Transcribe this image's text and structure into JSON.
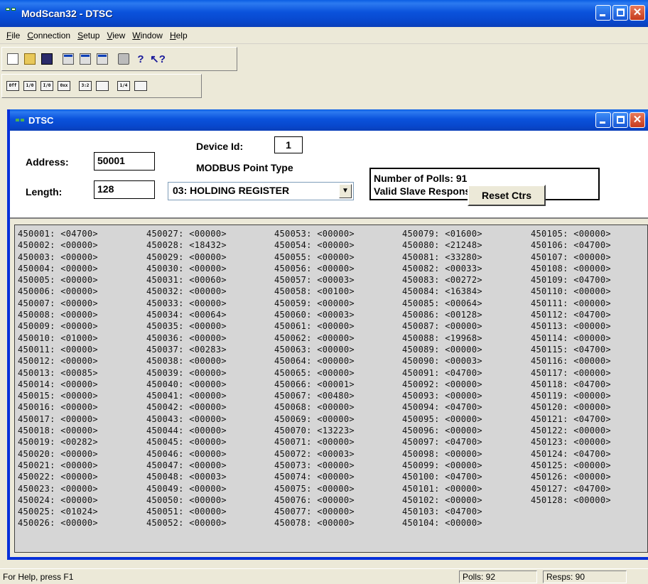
{
  "app": {
    "title": "ModScan32 - DTSC"
  },
  "menu": [
    {
      "pre": "",
      "u": "F",
      "post": "ile"
    },
    {
      "pre": "",
      "u": "C",
      "post": "onnection"
    },
    {
      "pre": "",
      "u": "S",
      "post": "etup"
    },
    {
      "pre": "",
      "u": "V",
      "post": "iew"
    },
    {
      "pre": "",
      "u": "W",
      "post": "indow"
    },
    {
      "pre": "",
      "u": "H",
      "post": "elp"
    }
  ],
  "toolbar2": [
    "0ff",
    "1/0",
    "I/0",
    "0xx",
    "3:2",
    "",
    "1/4",
    ""
  ],
  "doc": {
    "title": "DTSC",
    "address_label": "Address:",
    "address": "50001",
    "length_label": "Length:",
    "length": "128",
    "device_id_label": "Device Id:",
    "device_id": "1",
    "point_type_label": "MODBUS Point Type",
    "point_type": "03: HOLDING REGISTER",
    "polls_line": "Number of Polls: 91",
    "responses_line": "Valid Slave Responses: 90",
    "reset_label": "Reset Ctrs"
  },
  "registers": [
    [
      "450001: <04700>",
      "450002: <00000>",
      "450003: <00000>",
      "450004: <00000>",
      "450005: <00000>",
      "450006: <00000>",
      "450007: <00000>",
      "450008: <00000>",
      "450009: <00000>",
      "450010: <01000>",
      "450011: <00000>",
      "450012: <00000>",
      "450013: <00085>",
      "450014: <00000>",
      "450015: <00000>",
      "450016: <00000>",
      "450017: <00000>",
      "450018: <00000>",
      "450019: <00282>",
      "450020: <00000>",
      "450021: <00000>",
      "450022: <00000>",
      "450023: <00000>",
      "450024: <00000>",
      "450025: <01024>",
      "450026: <00000>"
    ],
    [
      "450027: <00000>",
      "450028: <18432>",
      "450029: <00000>",
      "450030: <00000>",
      "450031: <00060>",
      "450032: <00000>",
      "450033: <00000>",
      "450034: <00064>",
      "450035: <00000>",
      "450036: <00000>",
      "450037: <00283>",
      "450038: <00000>",
      "450039: <00000>",
      "450040: <00000>",
      "450041: <00000>",
      "450042: <00000>",
      "450043: <00000>",
      "450044: <00000>",
      "450045: <00000>",
      "450046: <00000>",
      "450047: <00000>",
      "450048: <00003>",
      "450049: <00000>",
      "450050: <00000>",
      "450051: <00000>",
      "450052: <00000>"
    ],
    [
      "450053: <00000>",
      "450054: <00000>",
      "450055: <00000>",
      "450056: <00000>",
      "450057: <00003>",
      "450058: <00100>",
      "450059: <00000>",
      "450060: <00003>",
      "450061: <00000>",
      "450062: <00000>",
      "450063: <00000>",
      "450064: <00000>",
      "450065: <00000>",
      "450066: <00001>",
      "450067: <00480>",
      "450068: <00000>",
      "450069: <00000>",
      "450070: <13223>",
      "450071: <00000>",
      "450072: <00003>",
      "450073: <00000>",
      "450074: <00000>",
      "450075: <00000>",
      "450076: <00000>",
      "450077: <00000>",
      "450078: <00000>"
    ],
    [
      "450079: <01600>",
      "450080: <21248>",
      "450081: <33280>",
      "450082: <00033>",
      "450083: <00272>",
      "450084: <16384>",
      "450085: <00064>",
      "450086: <00128>",
      "450087: <00000>",
      "450088: <19968>",
      "450089: <00000>",
      "450090: <00003>",
      "450091: <04700>",
      "450092: <00000>",
      "450093: <00000>",
      "450094: <04700>",
      "450095: <00000>",
      "450096: <00000>",
      "450097: <04700>",
      "450098: <00000>",
      "450099: <00000>",
      "450100: <04700>",
      "450101: <00000>",
      "450102: <00000>",
      "450103: <04700>",
      "450104: <00000>"
    ],
    [
      "450105: <00000>",
      "450106: <04700>",
      "450107: <00000>",
      "450108: <00000>",
      "450109: <04700>",
      "450110: <00000>",
      "450111: <00000>",
      "450112: <04700>",
      "450113: <00000>",
      "450114: <00000>",
      "450115: <04700>",
      "450116: <00000>",
      "450117: <00000>",
      "450118: <04700>",
      "450119: <00000>",
      "450120: <00000>",
      "450121: <04700>",
      "450122: <00000>",
      "450123: <00000>",
      "450124: <04700>",
      "450125: <00000>",
      "450126: <00000>",
      "450127: <04700>",
      "450128: <00000>"
    ]
  ],
  "status": {
    "help": "For Help, press F1",
    "polls": "Polls: 92",
    "resps": "Resps: 90"
  },
  "colors": {
    "titlebar": "#0a52dc",
    "data_bg": "#d6d6d6",
    "window_bg": "#ece9d8"
  }
}
